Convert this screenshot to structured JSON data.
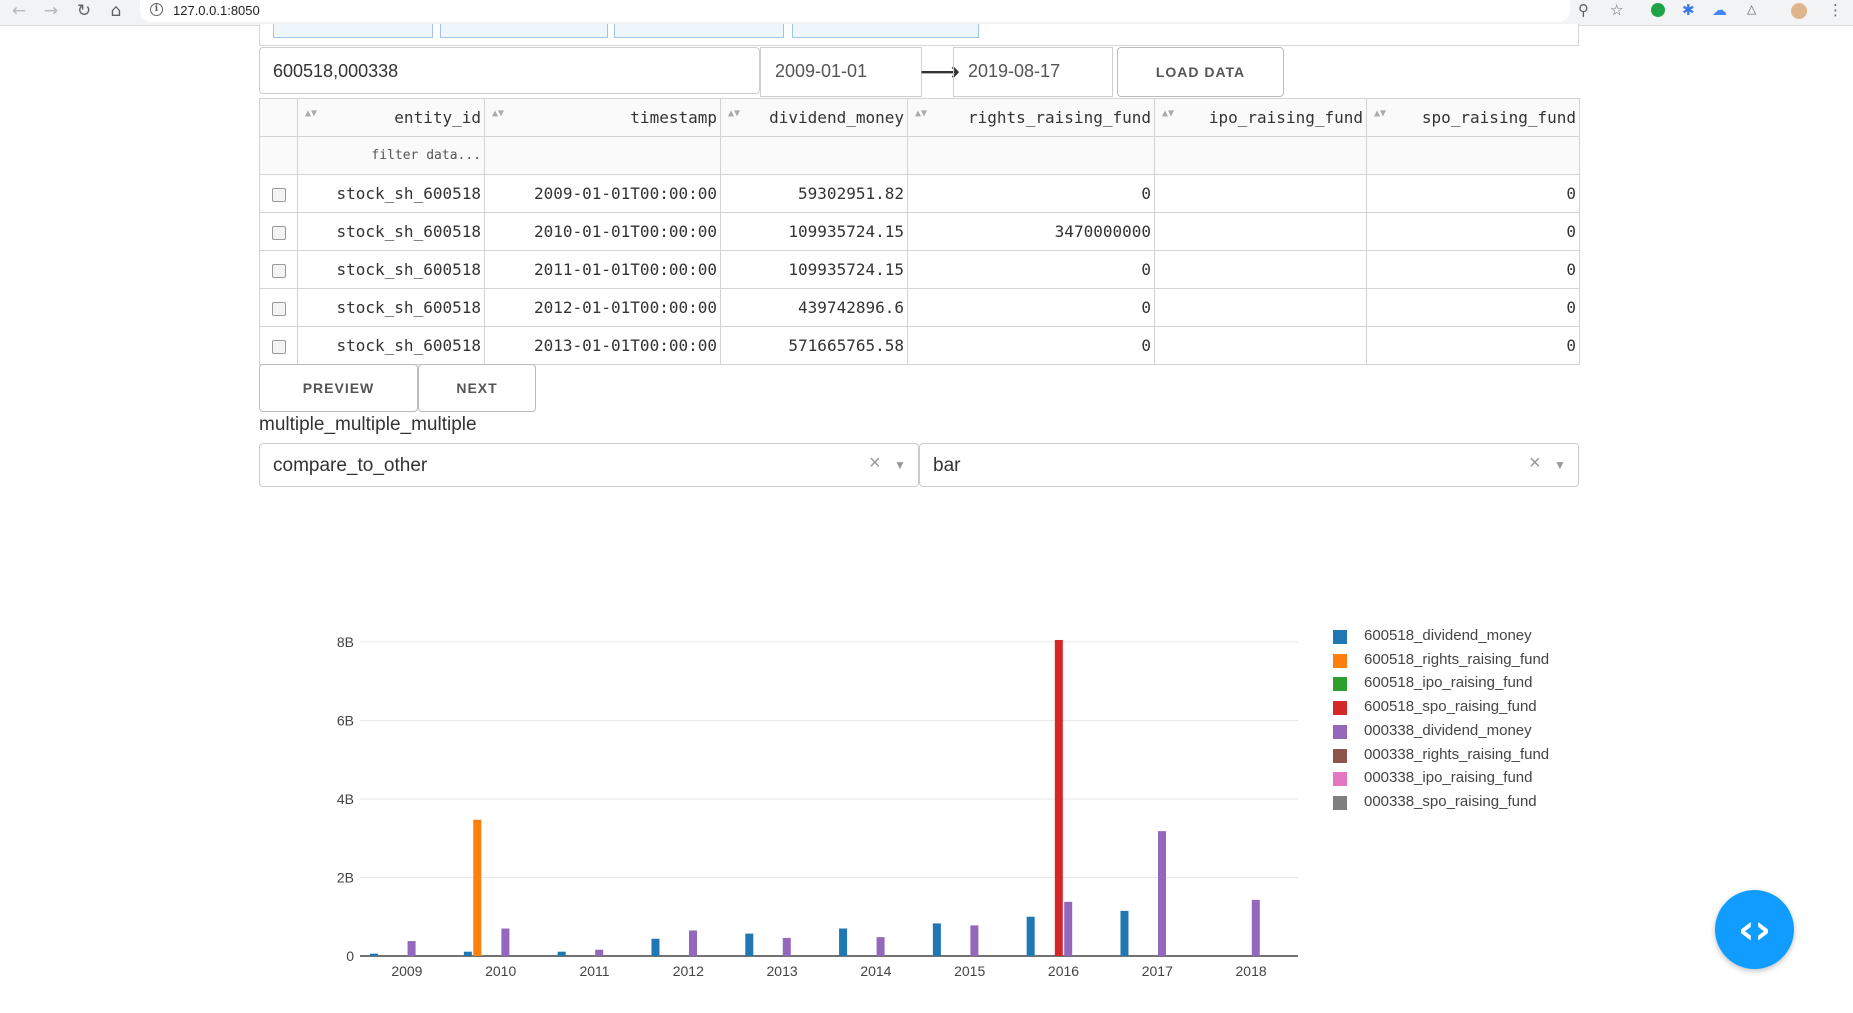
{
  "browser": {
    "url": "127.0.0.1:8050"
  },
  "controls": {
    "entity_ids": "600518,000338",
    "start_date": "2009-01-01",
    "end_date": "2019-08-17",
    "load_label": "LOAD DATA",
    "prev_label": "PREVIEW",
    "next_label": "NEXT"
  },
  "table": {
    "columns": [
      "entity_id",
      "timestamp",
      "dividend_money",
      "rights_raising_fund",
      "ipo_raising_fund",
      "spo_raising_fund"
    ],
    "filter_placeholder": "filter data...",
    "rows": [
      {
        "entity_id": "stock_sh_600518",
        "timestamp": "2009-01-01T00:00:00",
        "dividend_money": "59302951.82",
        "rights_raising_fund": "0",
        "ipo_raising_fund": "",
        "spo_raising_fund": "0"
      },
      {
        "entity_id": "stock_sh_600518",
        "timestamp": "2010-01-01T00:00:00",
        "dividend_money": "109935724.15",
        "rights_raising_fund": "3470000000",
        "ipo_raising_fund": "",
        "spo_raising_fund": "0"
      },
      {
        "entity_id": "stock_sh_600518",
        "timestamp": "2011-01-01T00:00:00",
        "dividend_money": "109935724.15",
        "rights_raising_fund": "0",
        "ipo_raising_fund": "",
        "spo_raising_fund": "0"
      },
      {
        "entity_id": "stock_sh_600518",
        "timestamp": "2012-01-01T00:00:00",
        "dividend_money": "439742896.6",
        "rights_raising_fund": "0",
        "ipo_raising_fund": "",
        "spo_raising_fund": "0"
      },
      {
        "entity_id": "stock_sh_600518",
        "timestamp": "2013-01-01T00:00:00",
        "dividend_money": "571665765.58",
        "rights_raising_fund": "0",
        "ipo_raising_fund": "",
        "spo_raising_fund": "0"
      }
    ]
  },
  "section_label": "multiple_multiple_multiple",
  "dropdowns": {
    "analysis_value": "compare_to_other",
    "chart_type_value": "bar"
  },
  "chart_data": {
    "type": "bar",
    "categories": [
      "2009",
      "2010",
      "2011",
      "2012",
      "2013",
      "2014",
      "2015",
      "2016",
      "2017",
      "2018"
    ],
    "ylim": [
      0,
      8.1
    ],
    "y_ticks": [
      0,
      2,
      4,
      6,
      8
    ],
    "y_tick_labels": [
      "0",
      "2B",
      "4B",
      "6B",
      "8B"
    ],
    "unit": "billions",
    "grid": true,
    "legend_position": "right",
    "series": [
      {
        "name": "600518_dividend_money",
        "color": "#1f77b4",
        "values": [
          0.06,
          0.11,
          0.11,
          0.44,
          0.57,
          0.7,
          0.83,
          1.0,
          1.15,
          null
        ]
      },
      {
        "name": "600518_rights_raising_fund",
        "color": "#ff7f0e",
        "values": [
          0,
          3.47,
          0,
          0,
          0,
          0,
          0,
          0,
          0,
          null
        ]
      },
      {
        "name": "600518_ipo_raising_fund",
        "color": "#2ca02c",
        "values": [
          null,
          null,
          null,
          null,
          null,
          null,
          null,
          null,
          null,
          null
        ]
      },
      {
        "name": "600518_spo_raising_fund",
        "color": "#d62728",
        "values": [
          0,
          0,
          0,
          0,
          0,
          0,
          0,
          8.05,
          0,
          null
        ]
      },
      {
        "name": "000338_dividend_money",
        "color": "#9467bd",
        "values": [
          0.38,
          0.7,
          0.16,
          0.65,
          0.46,
          0.48,
          0.78,
          1.38,
          3.18,
          1.43
        ]
      },
      {
        "name": "000338_rights_raising_fund",
        "color": "#8c564b",
        "values": [
          0,
          0,
          0,
          0,
          0,
          0,
          0,
          0,
          0,
          0
        ]
      },
      {
        "name": "000338_ipo_raising_fund",
        "color": "#e377c2",
        "values": [
          null,
          null,
          null,
          null,
          null,
          null,
          null,
          null,
          null,
          null
        ]
      },
      {
        "name": "000338_spo_raising_fund",
        "color": "#7f7f7f",
        "values": [
          0,
          0,
          0,
          0,
          0,
          0,
          0,
          0,
          0,
          0
        ]
      }
    ]
  }
}
